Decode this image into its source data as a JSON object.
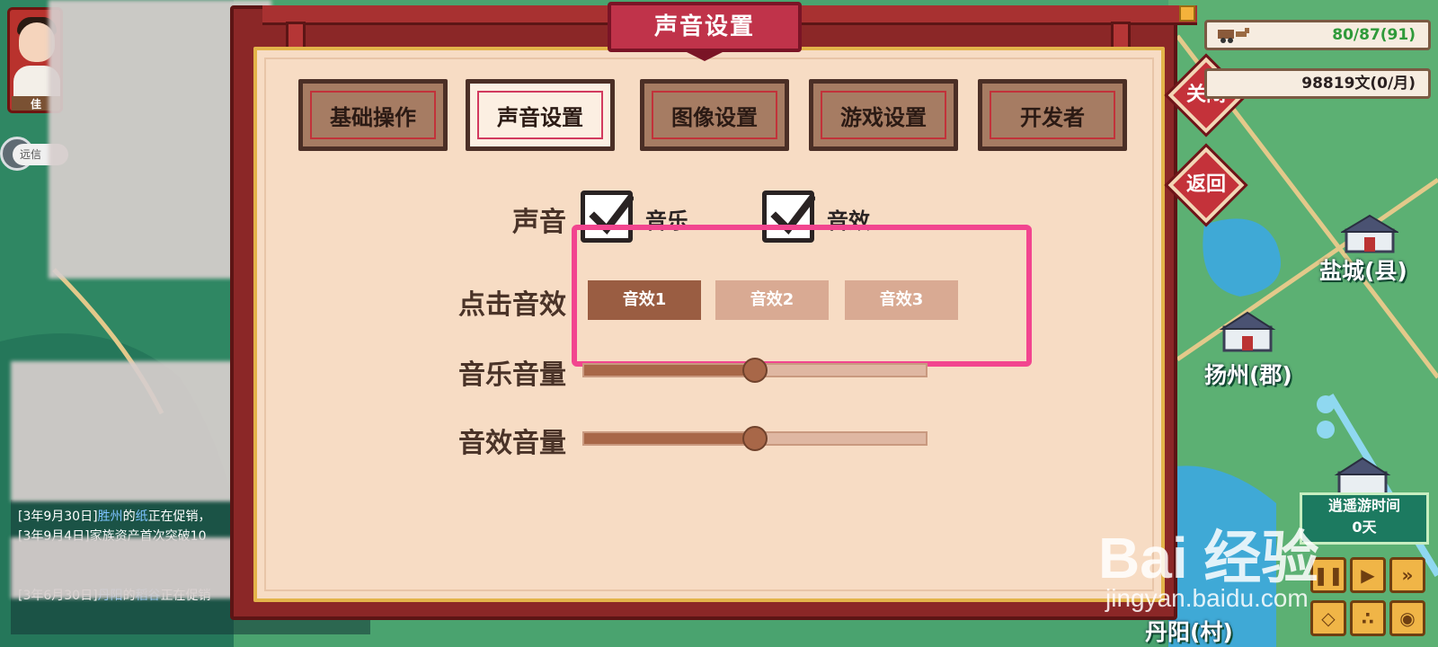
{
  "dialog": {
    "title": "声音设置",
    "tabs": [
      {
        "label": "基础操作",
        "active": false
      },
      {
        "label": "声音设置",
        "active": true
      },
      {
        "label": "图像设置",
        "active": false
      },
      {
        "label": "游戏设置",
        "active": false
      },
      {
        "label": "开发者",
        "active": false
      }
    ],
    "sound": {
      "label": "声音",
      "music": {
        "label": "音乐",
        "checked": true
      },
      "effects": {
        "label": "音效",
        "checked": true
      }
    },
    "click_sfx": {
      "label": "点击音效",
      "options": [
        "音效1",
        "音效2",
        "音效3"
      ],
      "selected_index": 0
    },
    "music_volume": {
      "label": "音乐音量",
      "value": 0.5
    },
    "sfx_volume": {
      "label": "音效音量",
      "value": 0.5
    },
    "side_buttons": {
      "close": "关闭",
      "back": "返回"
    }
  },
  "hud": {
    "avatar_tag": "佳",
    "message_chip": "远信",
    "cart_capacity": "80/87(91)",
    "money": "98819文(0/月)",
    "travel_time_label": "逍遥游时间",
    "travel_time_value": "0天"
  },
  "map": {
    "towns": [
      "盐城(县)",
      "扬州(郡)",
      "丹阳(村)"
    ]
  },
  "log": [
    {
      "date": "[3年9月30日]",
      "place": "胜州",
      "mid": "的",
      "item": "纸",
      "tail": "正在促销，"
    },
    {
      "date": "[3年9月4日]",
      "place": "",
      "mid": "",
      "item": "",
      "tail": "家族资产首次突破10"
    },
    {
      "date": "",
      "place": "",
      "mid": "",
      "item": "",
      "tail": ""
    },
    {
      "date": "",
      "place": "",
      "mid": "",
      "item": "",
      "tail": ""
    },
    {
      "date": "[3年6月30日]",
      "place": "丹阳",
      "mid": "的",
      "item": "稻谷",
      "tail": "正在促销"
    }
  ],
  "watermark": {
    "main": "Bai 经验",
    "sub": "jingyan.baidu.com"
  },
  "colors": {
    "frame": "#8b2727",
    "panel": "#f7dcc4",
    "accent_pink": "#f2458f",
    "selected": "#9a5d42",
    "unselected": "#d9aa93"
  }
}
